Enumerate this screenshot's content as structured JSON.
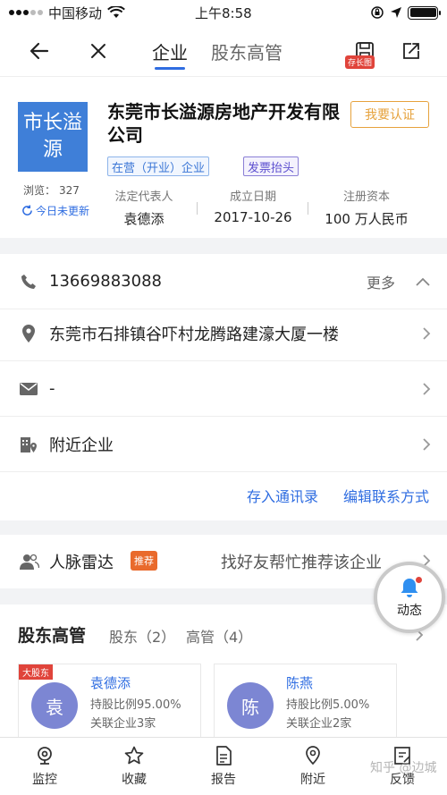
{
  "status_bar": {
    "carrier": "中国移动",
    "time": "上午8:58"
  },
  "nav": {
    "tabs": [
      {
        "label": "企业",
        "active": true
      },
      {
        "label": "股东高管",
        "active": false
      }
    ],
    "long_image_badge": "存长图"
  },
  "company": {
    "logo_text": "市长溢源",
    "name": "东莞市长溢源房地产开发有限公司",
    "claim_button": "我要认证",
    "tags": [
      "在营（开业）企业",
      "发票抬头"
    ],
    "views_label": "浏览：",
    "views_count": "327",
    "refresh_text": "今日未更新",
    "stats": [
      {
        "label": "法定代表人",
        "value": "袁德添"
      },
      {
        "label": "成立日期",
        "value": "2017-10-26"
      },
      {
        "label": "注册资本",
        "value": "100 万人民币"
      }
    ]
  },
  "contact": {
    "phone": "13669883088",
    "more_label": "更多",
    "address": "东莞市石排镇谷吓村龙腾路建濠大厦一楼",
    "email": "-",
    "nearby": "附近企业",
    "actions": [
      "存入通讯录",
      "编辑联系方式"
    ]
  },
  "network": {
    "label": "人脉雷达",
    "badge": "推荐",
    "hint": "找好友帮忙推荐该企业"
  },
  "float_button": {
    "label": "动态"
  },
  "shareholders": {
    "title": "股东高管",
    "shareholder_tab": "股东（2）",
    "executive_tab": "高管（4）",
    "items": [
      {
        "badge": "大股东",
        "avatar": "袁",
        "name": "袁德添",
        "ratio": "持股比例95.00%",
        "related": "关联企业3家"
      },
      {
        "badge": "",
        "avatar": "陈",
        "name": "陈燕",
        "ratio": "持股比例5.00%",
        "related": "关联企业2家"
      }
    ]
  },
  "tabbar": [
    "监控",
    "收藏",
    "报告",
    "附近",
    "反馈"
  ],
  "watermark": "知乎 @边城",
  "colors": {
    "accent": "#2f6de1",
    "logo_bg": "#3f7fd8",
    "claim": "#e6a23c",
    "badge_red": "#e0443b",
    "recommend": "#e96a2c"
  }
}
